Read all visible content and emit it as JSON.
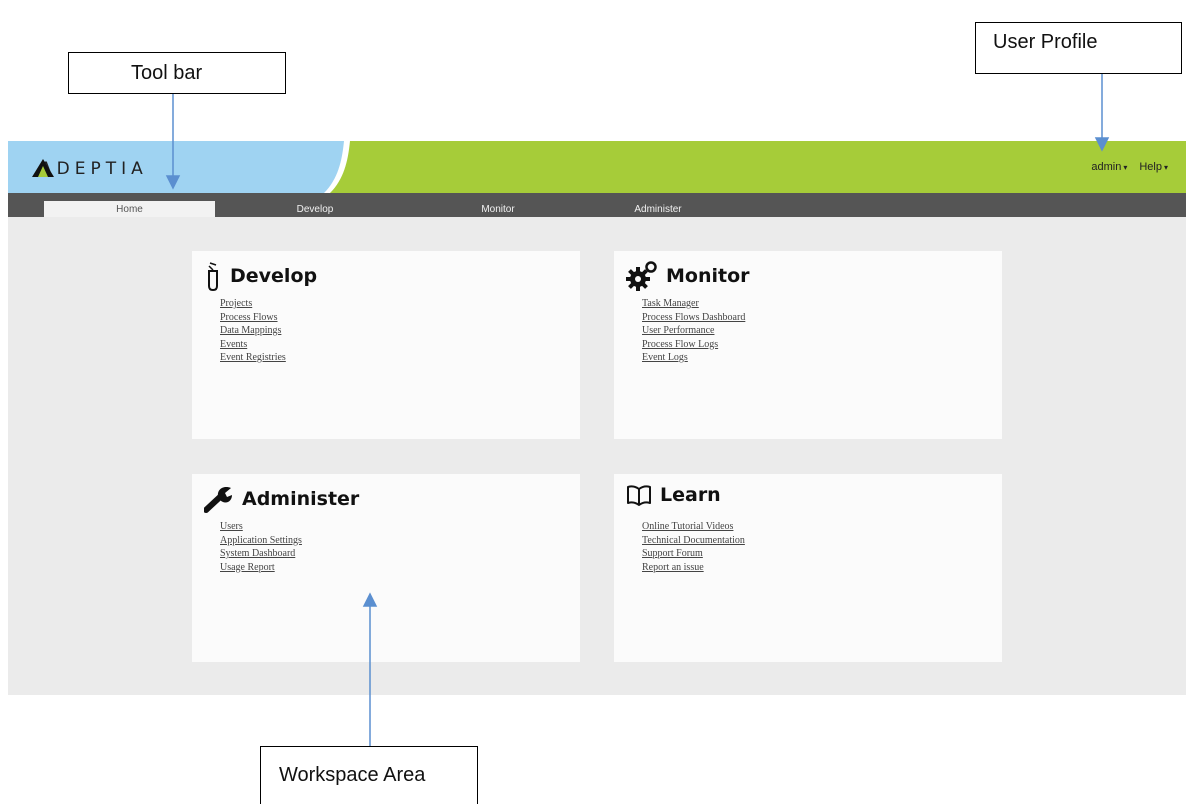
{
  "annotations": {
    "toolbar": "Tool bar",
    "user_profile": "User Profile",
    "workspace": "Workspace Area"
  },
  "header": {
    "brand": "ADEPTIA",
    "user_menu": {
      "user": "admin",
      "help": "Help"
    },
    "colors": {
      "green": "#a6cc39",
      "blue": "#9fd3f2",
      "nav": "#555555"
    }
  },
  "nav": {
    "tabs": [
      {
        "label": "Home",
        "active": true
      },
      {
        "label": "Develop"
      },
      {
        "label": "Monitor"
      },
      {
        "label": "Administer"
      }
    ]
  },
  "cards": {
    "develop": {
      "title": "Develop",
      "icon": "test-tube-icon",
      "links": [
        "Projects",
        "Process Flows",
        "Data Mappings",
        "Events",
        "Event Registries"
      ]
    },
    "monitor": {
      "title": "Monitor",
      "icon": "gears-icon",
      "links": [
        "Task Manager",
        "Process Flows Dashboard",
        "User Performance",
        "Process Flow Logs",
        "Event Logs"
      ]
    },
    "administer": {
      "title": "Administer",
      "icon": "wrench-icon",
      "links": [
        "Users",
        "Application Settings",
        "System Dashboard",
        "Usage Report"
      ]
    },
    "learn": {
      "title": "Learn",
      "icon": "book-icon",
      "links": [
        "Online Tutorial Videos",
        "Technical Documentation",
        "Support Forum",
        "Report an issue"
      ]
    }
  }
}
